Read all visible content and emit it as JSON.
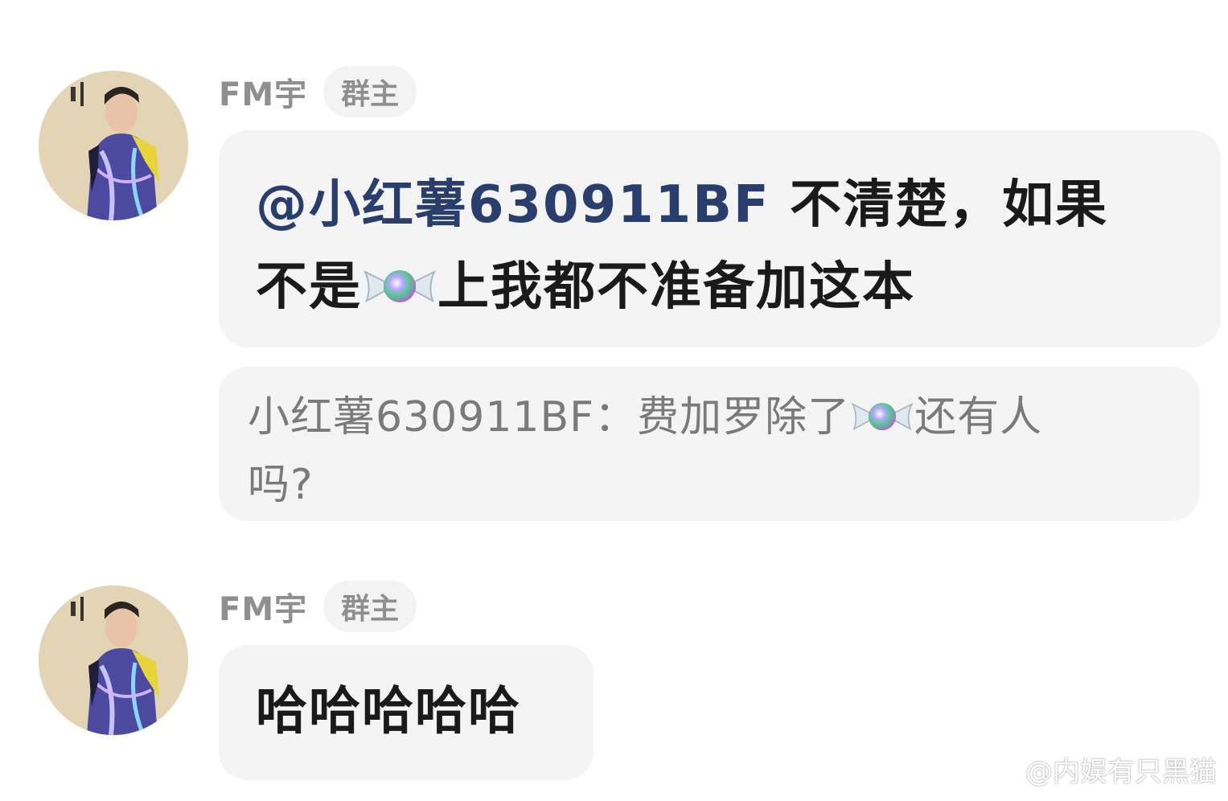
{
  "messages": [
    {
      "sender": "FM宇",
      "role": "群主",
      "mention": "@小红薯630911BF",
      "text_line1_after_mention": " 不清楚，如果",
      "text_line2_before_icon": "不是",
      "text_line2_after_icon": "上我都不准备加这本",
      "quote": {
        "author": "小红薯630911BF：",
        "text_before_icon": "费加罗除了",
        "text_after_icon": "还有人",
        "text_line2": "吗?"
      }
    },
    {
      "sender": "FM宇",
      "role": "群主",
      "text": "哈哈哈哈哈"
    }
  ],
  "icons": {
    "avatar": "user-avatar-photo",
    "candy": "candy-emoji-icon",
    "weibo": "weibo-logo-icon"
  },
  "watermark": {
    "text": "@内娱有只黑猫"
  },
  "colors": {
    "mention": "#2a3e6d",
    "bubble": "#f4f4f4",
    "badge": "#f3f3f3",
    "muted": "#8f8f8f"
  }
}
